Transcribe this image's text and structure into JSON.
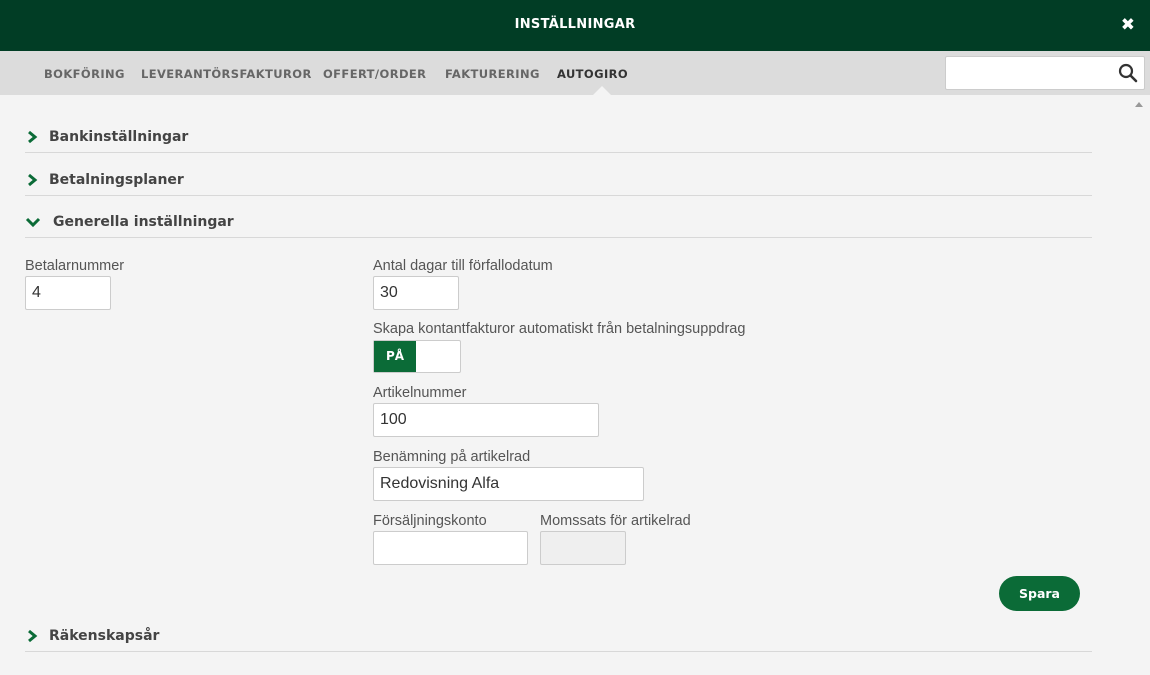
{
  "window": {
    "title": "INSTÄLLNINGAR",
    "close_symbol": "✖"
  },
  "tabs": [
    {
      "label": "BOKFÖRING",
      "active": false
    },
    {
      "label": "LEVERANTÖRSFAKTUROR",
      "active": false
    },
    {
      "label": "OFFERT/ORDER",
      "active": false
    },
    {
      "label": "FAKTURERING",
      "active": false
    },
    {
      "label": "AUTOGIRO",
      "active": true
    }
  ],
  "search": {
    "value": "",
    "placeholder": "",
    "icon": "search-icon"
  },
  "sections": [
    {
      "label": "Bankinställningar",
      "expanded": false
    },
    {
      "label": "Betalningsplaner",
      "expanded": false
    },
    {
      "label": "Generella inställningar",
      "expanded": true
    },
    {
      "label": "Räkenskapsår",
      "expanded": false
    }
  ],
  "general": {
    "payer_number": {
      "label": "Betalarnummer",
      "value": "4"
    },
    "due_days": {
      "label": "Antal dagar till förfallodatum",
      "value": "30"
    },
    "auto_cash_invoice": {
      "label": "Skapa kontantfakturor automatiskt från betalningsuppdrag",
      "toggle_label": "PÅ",
      "on": true
    },
    "article_number": {
      "label": "Artikelnummer",
      "value": "100"
    },
    "article_row_name": {
      "label": "Benämning på artikelrad",
      "value": "Redovisning Alfa"
    },
    "sales_account": {
      "label": "Försäljningskonto",
      "value": ""
    },
    "vat_rate": {
      "label": "Momssats för artikelrad",
      "value": ""
    },
    "save_label": "Spara"
  },
  "colors": {
    "header_bg": "#013d25",
    "accent": "#0b6b37",
    "tab_bar_bg": "#dcdcdc",
    "page_bg": "#f4f4f4"
  }
}
